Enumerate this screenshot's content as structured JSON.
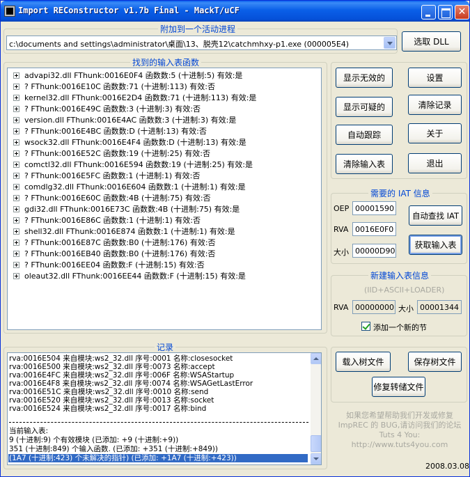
{
  "window": {
    "title": "Import REConstructor v1.7b Final - MackT/uCF"
  },
  "attach": {
    "group_title": "附加到一个活动进程",
    "process_path": "c:\\documents and settings\\administrator\\桌面\\13、脱壳12\\catchmhxy-p1.exe (000005E4)",
    "pick_dll_label": "选取 DLL"
  },
  "imports": {
    "group_title": "找到的输入表函数",
    "items": [
      "advapi32.dll FThunk:0016E0F4 函数数:5 (十进制:5) 有效:是",
      "? FThunk:0016E10C 函数数:71 (十进制:113) 有效:否",
      "kernel32.dll FThunk:0016E2D4 函数数:71 (十进制:113) 有效:是",
      "? FThunk:0016E49C 函数数:3 (十进制:3) 有效:否",
      "version.dll FThunk:0016E4AC 函数数:3 (十进制:3) 有效:是",
      "? FThunk:0016E4BC 函数数:D (十进制:13) 有效:否",
      "wsock32.dll FThunk:0016E4F4 函数数:D (十进制:13) 有效:是",
      "? FThunk:0016E52C 函数数:19 (十进制:25) 有效:否",
      "comctl32.dll FThunk:0016E594 函数数:19 (十进制:25) 有效:是",
      "? FThunk:0016E5FC 函数数:1 (十进制:1) 有效:否",
      "comdlg32.dll FThunk:0016E604 函数数:1 (十进制:1) 有效:是",
      "? FThunk:0016E60C 函数数:4B (十进制:75) 有效:否",
      "gdi32.dll FThunk:0016E73C 函数数:4B (十进制:75) 有效:是",
      "? FThunk:0016E86C 函数数:1 (十进制:1) 有效:否",
      "shell32.dll FThunk:0016E874 函数数:1 (十进制:1) 有效:是",
      "? FThunk:0016E87C 函数数:B0 (十进制:176) 有效:否",
      "? FThunk:0016EB40 函数数:B0 (十进制:176) 有效:否",
      "? FThunk:0016EE04 函数数:F (十进制:15) 有效:否",
      "oleaut32.dll FThunk:0016EE44 函数数:F (十进制:15) 有效:是"
    ]
  },
  "actions": {
    "show_invalid": "显示无效的",
    "show_suspect": "显示可疑的",
    "auto_trace": "自动跟踪",
    "clear_imports": "清除输入表",
    "settings": "设置",
    "clear_log": "清除记录",
    "about": "关于",
    "exit": "退出"
  },
  "iat": {
    "group_title": "需要的 IAT 信息",
    "oep_label": "OEP",
    "oep_value": "00001590",
    "rva_label": "RVA",
    "rva_value": "0016E0F0",
    "size_label": "大小",
    "size_value": "00000D90",
    "iat_autosearch": "自动查找 IAT",
    "get_imports": "获取输入表"
  },
  "new_import": {
    "group_title": "新建输入表信息",
    "subtitle": "(IID+ASCII+LOADER)",
    "rva_label": "RVA",
    "rva_value": "00000000",
    "size_label": "大小",
    "size_value": "00001344",
    "add_section_label": "添加一个新的节"
  },
  "log": {
    "group_title": "记录",
    "lines": [
      "rva:0016E504 来自模块:ws2_32.dll 序号:0001 名称:closesocket",
      "rva:0016E500 来自模块:ws2_32.dll 序号:0073 名称:accept",
      "rva:0016E4FC 来自模块:ws2_32.dll 序号:006F 名称:WSAStartup",
      "rva:0016E4F8 来自模块:ws2_32.dll 序号:0074 名称:WSAGetLastError",
      "rva:0016E51C 来自模块:ws2_32.dll 序号:0010 名称:send",
      "rva:0016E520 来自模块:ws2_32.dll 序号:0013 名称:socket",
      "rva:0016E524 来自模块:ws2_32.dll 序号:0017 名称:bind"
    ],
    "current_label": "当前输入表:",
    "summary": [
      "9 (十进制:9) 个有效模块 (已添加: +9 (十进制:+9))",
      "351 (十进制:849) 个输入函数. (已添加: +351 (十进制:+849))"
    ],
    "selected_line": "(1A7 (十进制:423) 个未解决的指针) (已添加: +1A7 (十进制:+423))"
  },
  "tree_files": {
    "load_tree": "载入树文件",
    "save_tree": "保存树文件",
    "fix_dump": "修复转储文件"
  },
  "credits": {
    "line1": "如果您希望帮助我们开发或修复",
    "line2": "ImpREC 的 BUG,请访问我们的论坛",
    "line3": "Tuts 4 You: http://www.tuts4you.com"
  },
  "date": "2008.03.08"
}
